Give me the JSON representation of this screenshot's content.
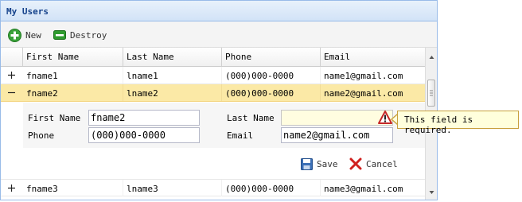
{
  "window": {
    "title": "My Users"
  },
  "toolbar": {
    "new_label": "New",
    "destroy_label": "Destroy"
  },
  "columns": [
    "First Name",
    "Last Name",
    "Phone",
    "Email"
  ],
  "rows": [
    {
      "first": "fname1",
      "last": "lname1",
      "phone": "(000)000-0000",
      "email": "name1@gmail.com",
      "expander": "+"
    },
    {
      "first": "fname2",
      "last": "lname2",
      "phone": "(000)000-0000",
      "email": "name2@gmail.com",
      "expander": "−"
    },
    {
      "first": "fname3",
      "last": "lname3",
      "phone": "(000)000-0000",
      "email": "name3@gmail.com",
      "expander": "+"
    }
  ],
  "editor": {
    "first_label": "First Name",
    "first_value": "fname2",
    "last_label": "Last Name",
    "last_value": "",
    "phone_label": "Phone",
    "phone_value": "(000)000-0000",
    "email_label": "Email",
    "email_value": "name2@gmail.com",
    "save_label": "Save",
    "cancel_label": "Cancel"
  },
  "validation": {
    "message": "This field is required."
  },
  "colors": {
    "selected_row": "#fbe9a6",
    "title_text": "#15428b",
    "tooltip_bg": "#ffffdc"
  }
}
